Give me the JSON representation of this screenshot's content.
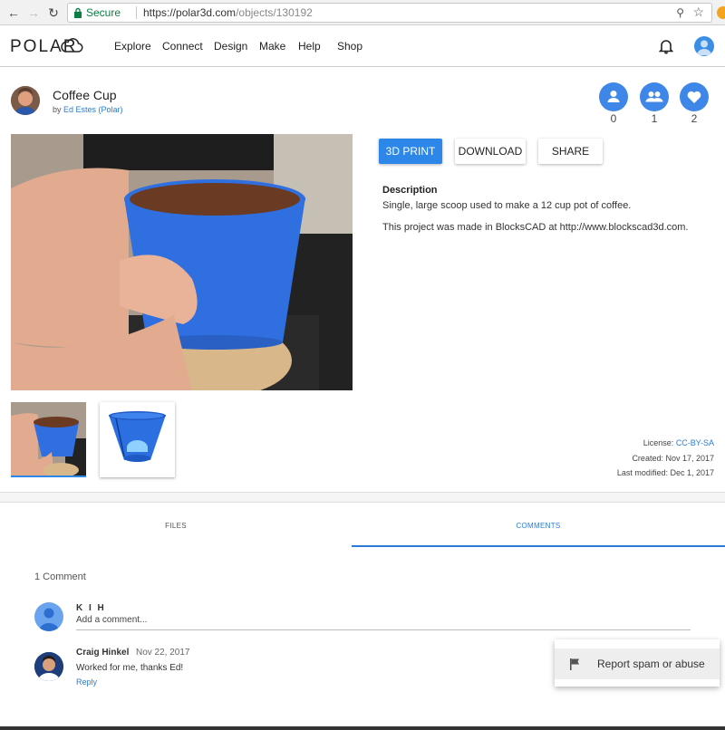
{
  "browser": {
    "secure_label": "Secure",
    "url_host": "https://polar3d.com",
    "url_path": "/objects/130192"
  },
  "header": {
    "logo": "POLAR",
    "nav": [
      "Explore",
      "Connect",
      "Design",
      "Make",
      "Help",
      "Shop"
    ]
  },
  "object": {
    "title": "Coffee Cup",
    "by_prefix": "by",
    "author": "Ed Estes (Polar)",
    "counts": {
      "followers": "0",
      "groups": "1",
      "likes": "2"
    }
  },
  "actions": {
    "print": "3D PRINT",
    "download": "DOWNLOAD",
    "share": "SHARE"
  },
  "description": {
    "label": "Description",
    "line1": "Single, large scoop used to make a 12 cup pot of coffee.",
    "line2": "This project was made in BlocksCAD at http://www.blockscad3d.com."
  },
  "meta": {
    "license_label": "License:",
    "license_value": "CC-BY-SA",
    "created": "Created: Nov 17, 2017",
    "modified": "Last modified: Dec 1, 2017"
  },
  "tabs": {
    "files": "FILES",
    "comments": "COMMENTS"
  },
  "comments": {
    "count": "1 Comment",
    "current_user": "K I H",
    "add_placeholder": "Add a comment...",
    "items": [
      {
        "author": "Craig Hinkel",
        "date": "Nov 22, 2017",
        "text": "Worked for me, thanks Ed!",
        "reply": "Reply"
      }
    ]
  },
  "menu": {
    "report": "Report spam or abuse"
  },
  "colors": {
    "accent": "#2d87e8",
    "secure": "#0b8043"
  }
}
